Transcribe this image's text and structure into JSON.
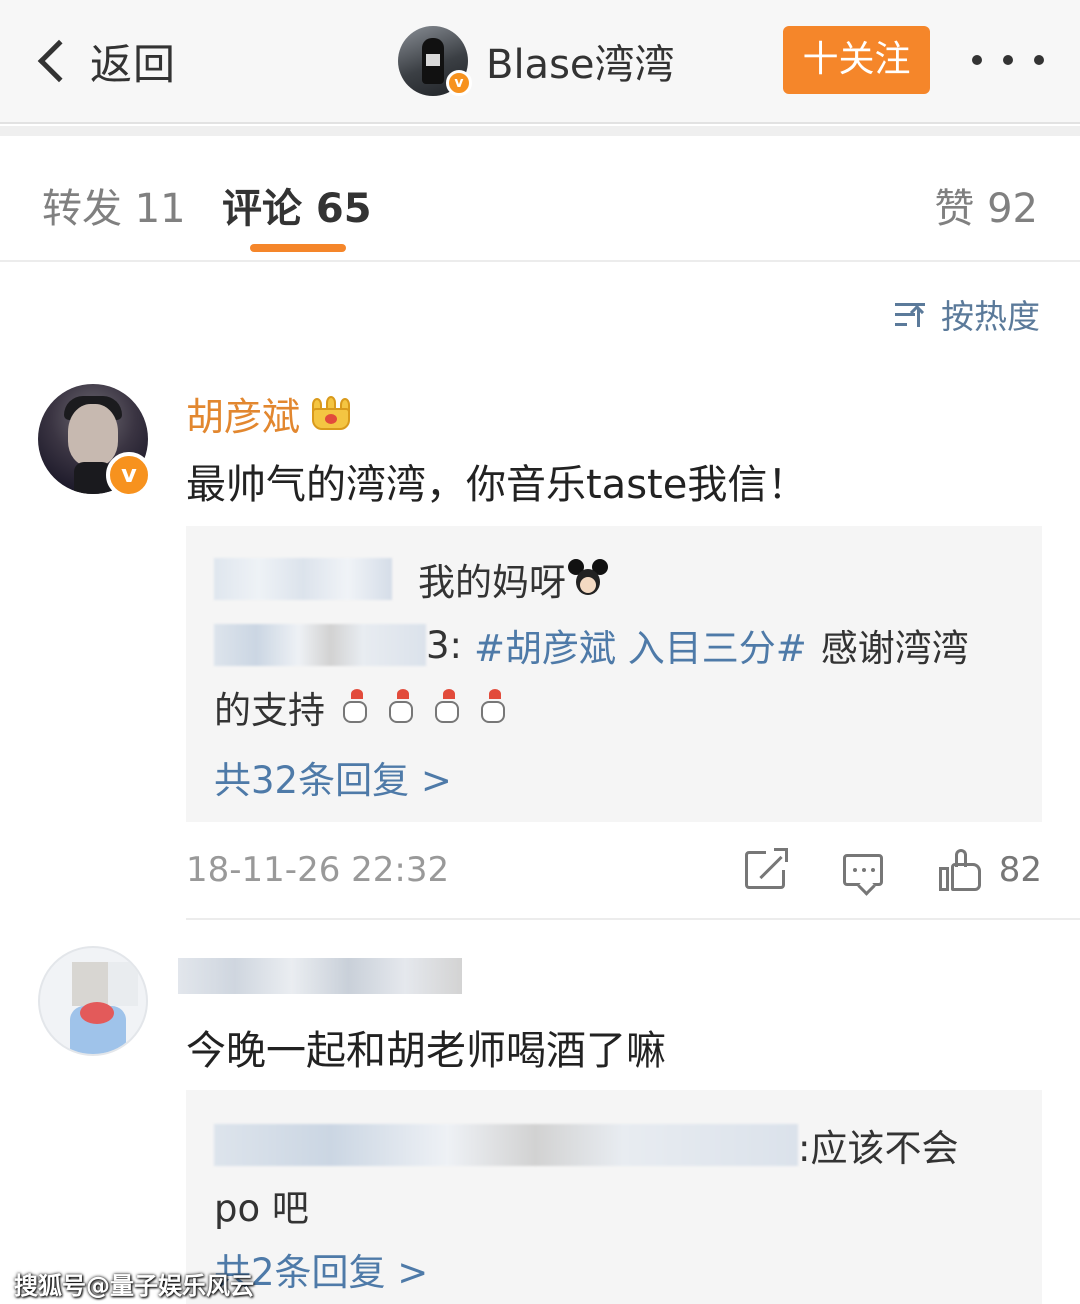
{
  "nav": {
    "back_label": "返回",
    "username": "Blase湾湾",
    "follow_label": "十关注"
  },
  "tabs": {
    "repost": "转发 11",
    "comment": "评论 65",
    "like": "赞 92"
  },
  "sort": {
    "label": "按热度"
  },
  "comments": [
    {
      "author": "胡彦斌",
      "text": "最帅气的湾湾，你音乐taste我信！",
      "replies": {
        "line1_text": "我的妈呀",
        "line2_prefix": "3:",
        "line2_hashtag": "#胡彦斌 入目三分#",
        "line2_suffix": "感谢湾湾",
        "line3_text": "的支持",
        "more": "共32条回复 >"
      },
      "time": "18-11-26 22:32",
      "likes": "82"
    },
    {
      "text": "今晚一起和胡老师喝酒了嘛",
      "replies": {
        "line1_text": ":应该不会",
        "line2_text": "po 吧",
        "more": "共2条回复 >"
      }
    }
  ],
  "watermark": "搜狐号@量子娱乐风云",
  "colors": {
    "accent": "#f5862a",
    "link": "#4e7aa8",
    "author": "#e2872f"
  },
  "icons": [
    "back-chevron-icon",
    "more-dots-icon",
    "sort-icon",
    "crown-icon",
    "share-icon",
    "comment-icon",
    "like-icon"
  ]
}
